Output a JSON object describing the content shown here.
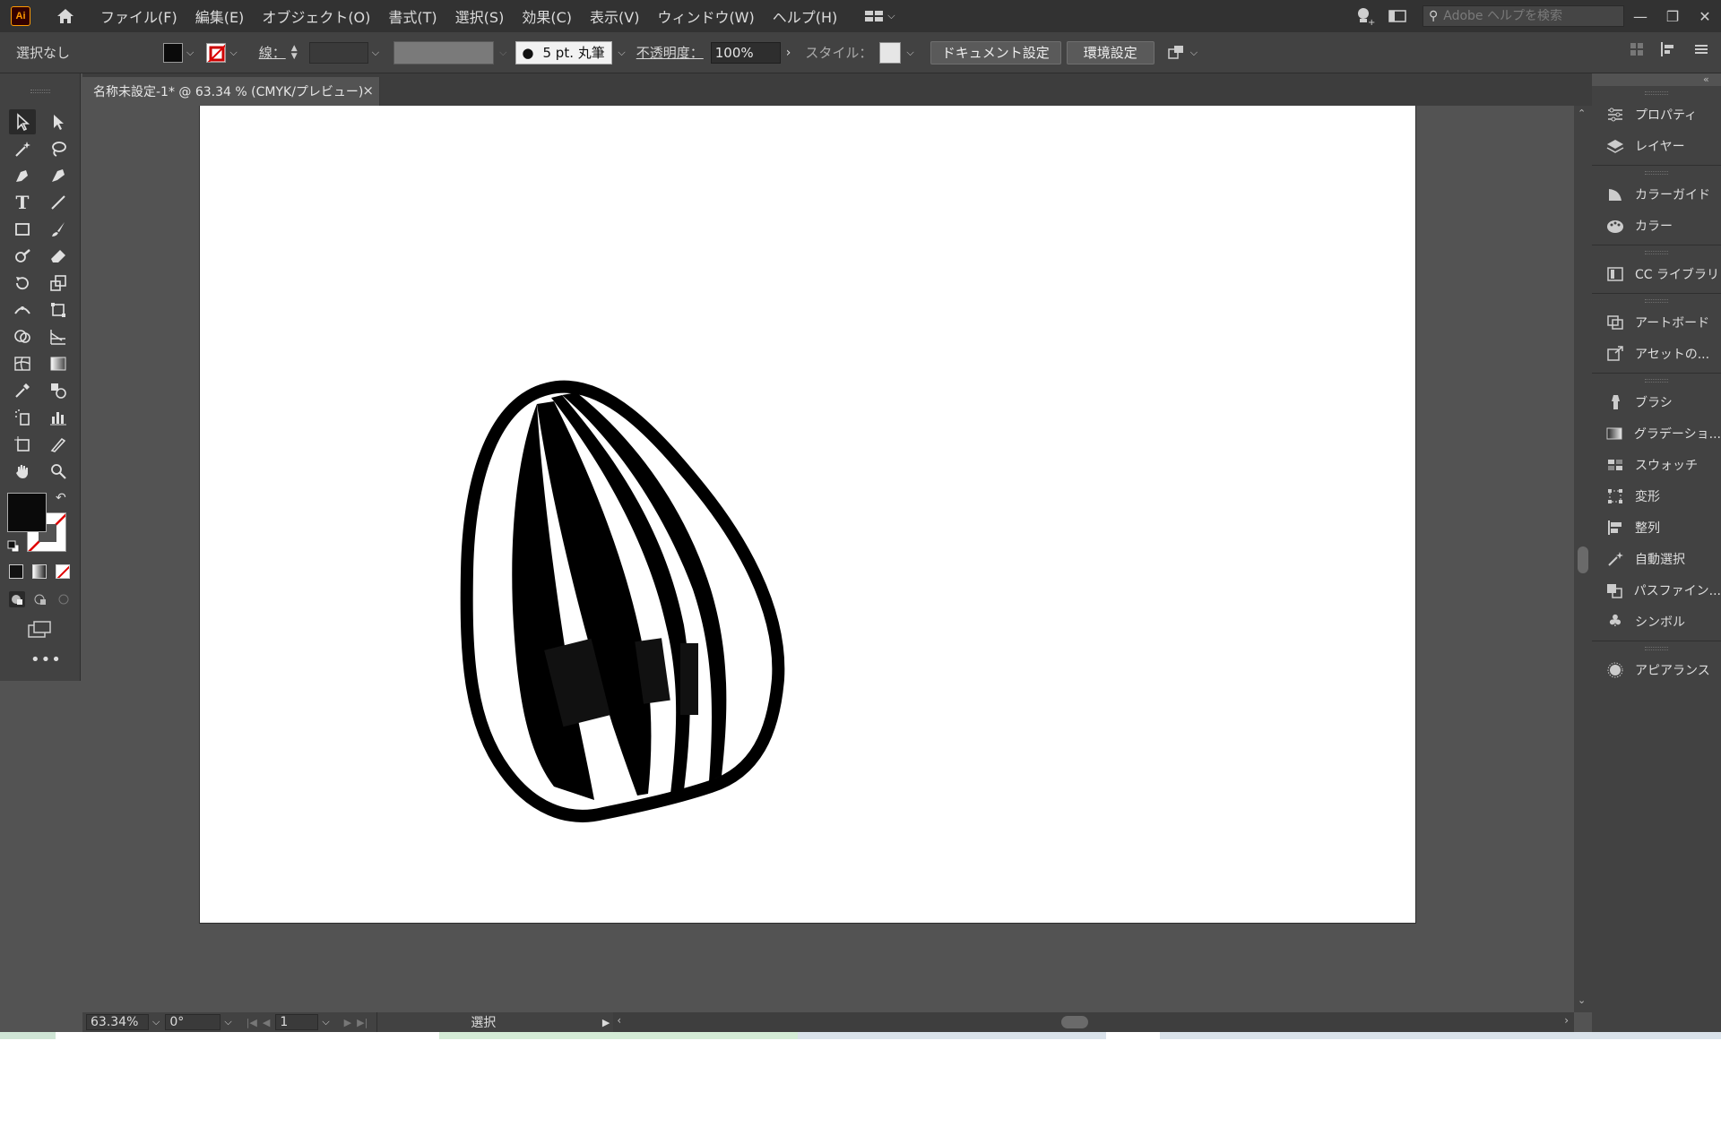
{
  "app": {
    "logo": "Ai"
  },
  "menu": [
    "ファイル(F)",
    "編集(E)",
    "オブジェクト(O)",
    "書式(T)",
    "選択(S)",
    "効果(C)",
    "表示(V)",
    "ウィンドウ(W)",
    "ヘルプ(H)"
  ],
  "search": {
    "placeholder": "Adobe ヘルプを検索"
  },
  "control": {
    "selection": "選択なし",
    "stroke_label": "線：",
    "brush": "5 pt. 丸筆",
    "opacity_label": "不透明度：",
    "opacity_value": "100%",
    "style_label": "スタイル：",
    "document_settings": "ドキュメント設定",
    "preferences": "環境設定"
  },
  "document": {
    "tab_title": "名称未設定-1* @ 63.34 % (CMYK/プレビュー)",
    "close": "×"
  },
  "status": {
    "zoom": "63.34%",
    "rotation": "0°",
    "artboard": "1",
    "tool": "選択"
  },
  "panels": {
    "group1": [
      "プロパティ",
      "レイヤー"
    ],
    "group2": [
      "カラーガイド",
      "カラー"
    ],
    "group3": [
      "CC ライブラリ"
    ],
    "group4": [
      "アートボード",
      "アセットの..."
    ],
    "group5": [
      "ブラシ",
      "グラデーショ...",
      "スウォッチ",
      "変形",
      "整列",
      "自動選択",
      "パスファイン...",
      "シンボル"
    ],
    "group6": [
      "アピアランス"
    ]
  },
  "colors": {
    "fill": "#0a0a0a",
    "stroke": "none",
    "accent": "#ff9a00"
  }
}
